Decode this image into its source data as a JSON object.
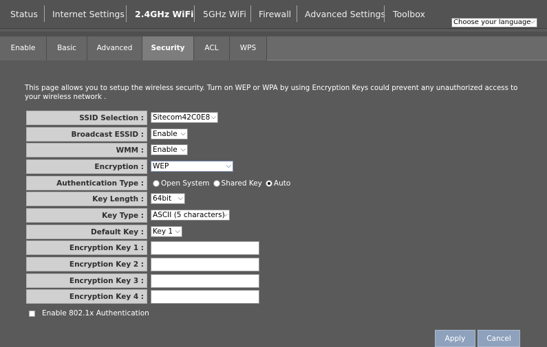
{
  "nav": {
    "items": [
      "Status",
      "Internet Settings",
      "2.4GHz WiFi",
      "5GHz WiFi",
      "Firewall",
      "Advanced Settings",
      "Toolbox"
    ],
    "active": "2.4GHz WiFi",
    "language_select": "Choose your language"
  },
  "subtabs": {
    "items": [
      "Enable",
      "Basic",
      "Advanced",
      "Security",
      "ACL",
      "WPS"
    ],
    "active": "Security"
  },
  "description": "This page allows you to setup the wireless security. Turn on WEP or WPA by using Encryption Keys could prevent any unauthorized access to your wireless network .",
  "form": {
    "ssid_selection": {
      "label": "SSID Selection :",
      "value": "Sitecom42C0E8"
    },
    "broadcast_essid": {
      "label": "Broadcast ESSID :",
      "value": "Enable"
    },
    "wmm": {
      "label": "WMM :",
      "value": "Enable"
    },
    "encryption": {
      "label": "Encryption :",
      "value": "WEP"
    },
    "authentication_type": {
      "label": "Authentication Type :",
      "options": [
        "Open System",
        "Shared Key",
        "Auto"
      ],
      "selected": "Auto"
    },
    "key_length": {
      "label": "Key Length :",
      "value": "64bit"
    },
    "key_type": {
      "label": "Key Type :",
      "value": "ASCII (5 characters)"
    },
    "default_key": {
      "label": "Default Key :",
      "value": "Key 1"
    },
    "encryption_key_1": {
      "label": "Encryption Key 1 :",
      "value": ""
    },
    "encryption_key_2": {
      "label": "Encryption Key 2 :",
      "value": ""
    },
    "encryption_key_3": {
      "label": "Encryption Key 3 :",
      "value": ""
    },
    "encryption_key_4": {
      "label": "Encryption Key 4 :",
      "value": ""
    },
    "enable_8021x": {
      "label": "Enable 802.1x Authentication",
      "checked": false
    }
  },
  "buttons": {
    "apply": "Apply",
    "cancel": "Cancel"
  },
  "colors": {
    "page_bg": "#5a5a5a",
    "label_bg": "#d0d0d0",
    "button_bg": "#8ea2bd"
  },
  "icons": {
    "dropdown": "chevron-down-icon",
    "radio": "radio-button-icon",
    "checkbox": "checkbox-icon"
  }
}
